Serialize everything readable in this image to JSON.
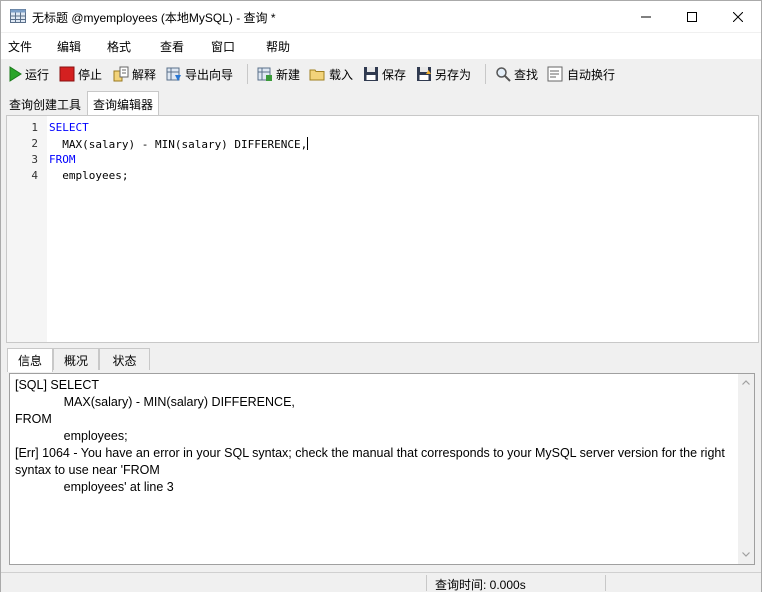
{
  "window": {
    "title": "无标题 @myemployees (本地MySQL) - 查询 *"
  },
  "menu": {
    "items": [
      "文件",
      "编辑",
      "格式",
      "查看",
      "窗口",
      "帮助"
    ]
  },
  "toolbar": {
    "run": "运行",
    "stop": "停止",
    "explain": "解释",
    "export_wizard": "导出向导",
    "new": "新建",
    "load": "载入",
    "save": "保存",
    "save_as": "另存为",
    "find": "查找",
    "word_wrap": "自动换行"
  },
  "editor_tabs": {
    "builder": "查询创建工具",
    "editor": "查询编辑器"
  },
  "editor": {
    "line_numbers": [
      "1",
      "2",
      "3",
      "4"
    ],
    "line1": "SELECT",
    "line2": "  MAX(salary) - MIN(salary) DIFFERENCE,",
    "line3": "FROM",
    "line4": "  employees;"
  },
  "result_tabs": {
    "info": "信息",
    "overview": "概况",
    "status": "状态"
  },
  "messages": {
    "text": "[SQL] SELECT\n              MAX(salary) - MIN(salary) DIFFERENCE,\nFROM\n              employees;\n[Err] 1064 - You have an error in your SQL syntax; check the manual that corresponds to your MySQL server version for the right syntax to use near 'FROM\n              employees' at line 3"
  },
  "statusbar": {
    "query_time": "查询时间: 0.000s"
  },
  "colors": {
    "keyword": "#0000ff",
    "run_icon": "#2aa52a",
    "stop_icon": "#d42020"
  }
}
